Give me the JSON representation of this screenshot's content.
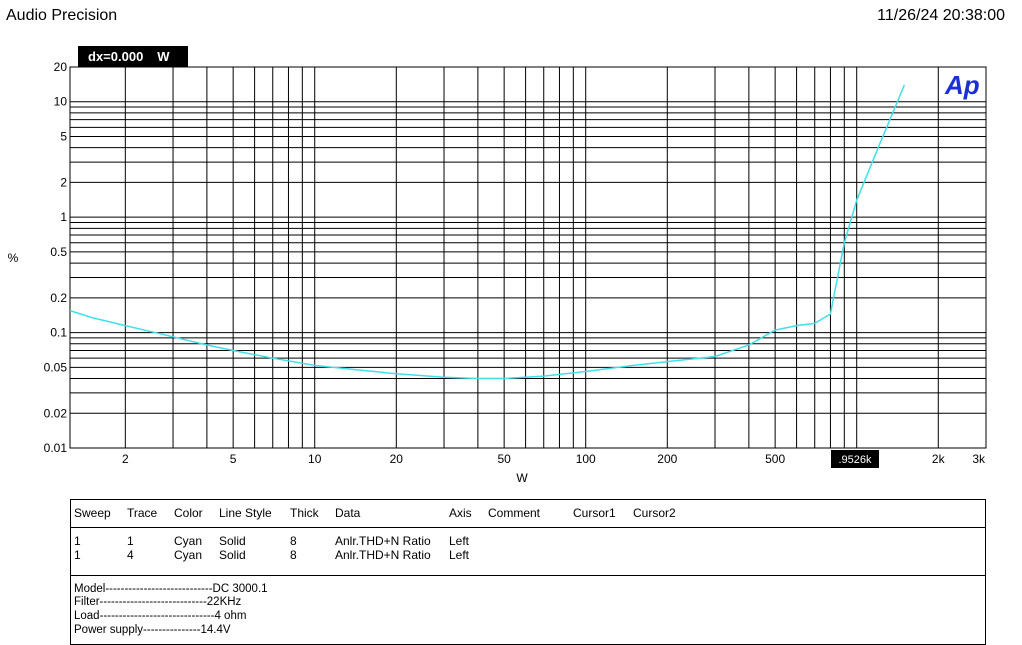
{
  "header": {
    "title": "Audio Precision",
    "datetime": "11/26/24 20:38:00"
  },
  "cursor_readout": {
    "label": "dx=0.000",
    "unit": "W",
    "x_marker": ".9526k"
  },
  "logo": "Ap",
  "colors": {
    "trace": "#40e0e8",
    "grid": "#000000",
    "logo": "#1a2fd6"
  },
  "chart_data": {
    "type": "line",
    "xlabel": "W",
    "ylabel": "%",
    "x_scale": "log",
    "y_scale": "log",
    "xlim": [
      1.25,
      3000
    ],
    "ylim": [
      0.01,
      20
    ],
    "x_tick_labels": [
      "2",
      "5",
      "10",
      "20",
      "50",
      "100",
      "200",
      "500",
      "2k",
      "3k"
    ],
    "x_tick_values": [
      2,
      5,
      10,
      20,
      50,
      100,
      200,
      500,
      2000,
      3000
    ],
    "y_tick_labels": [
      "20",
      "10",
      "5",
      "2",
      "1",
      "0.5",
      "0.2",
      "0.1",
      "0.05",
      "0.02",
      "0.01"
    ],
    "y_tick_values": [
      20,
      10,
      5,
      2,
      1,
      0.5,
      0.2,
      0.1,
      0.05,
      0.02,
      0.01
    ],
    "grid": true,
    "series": [
      {
        "points": [
          [
            1.25,
            0.155
          ],
          [
            1.5,
            0.135
          ],
          [
            2,
            0.115
          ],
          [
            3,
            0.092
          ],
          [
            4,
            0.078
          ],
          [
            5,
            0.07
          ],
          [
            7,
            0.06
          ],
          [
            10,
            0.052
          ],
          [
            15,
            0.047
          ],
          [
            20,
            0.044
          ],
          [
            30,
            0.041
          ],
          [
            40,
            0.04
          ],
          [
            50,
            0.04
          ],
          [
            70,
            0.042
          ],
          [
            100,
            0.046
          ],
          [
            150,
            0.052
          ],
          [
            200,
            0.056
          ],
          [
            300,
            0.062
          ],
          [
            400,
            0.078
          ],
          [
            500,
            0.105
          ],
          [
            600,
            0.115
          ],
          [
            700,
            0.12
          ],
          [
            800,
            0.145
          ],
          [
            900,
            0.6
          ],
          [
            1000,
            1.4
          ],
          [
            1200,
            4.0
          ],
          [
            1500,
            14.0
          ]
        ]
      }
    ]
  },
  "legend_table": {
    "headers": [
      "Sweep",
      "Trace",
      "Color",
      "Line Style",
      "Thick",
      "Data",
      "Axis",
      "Comment",
      "Cursor1",
      "Cursor2"
    ],
    "rows": [
      [
        "1",
        "1",
        "Cyan",
        "Solid",
        "8",
        "Anlr.THD+N Ratio",
        "Left",
        "",
        "",
        ""
      ],
      [
        "1",
        "4",
        "Cyan",
        "Solid",
        "8",
        "Anlr.THD+N Ratio",
        "Left",
        "",
        "",
        ""
      ]
    ]
  },
  "notes": [
    "Model----------------------------DC 3000.1",
    "Filter----------------------------22KHz",
    "Load------------------------------4 ohm",
    "Power supply---------------14.4V"
  ]
}
